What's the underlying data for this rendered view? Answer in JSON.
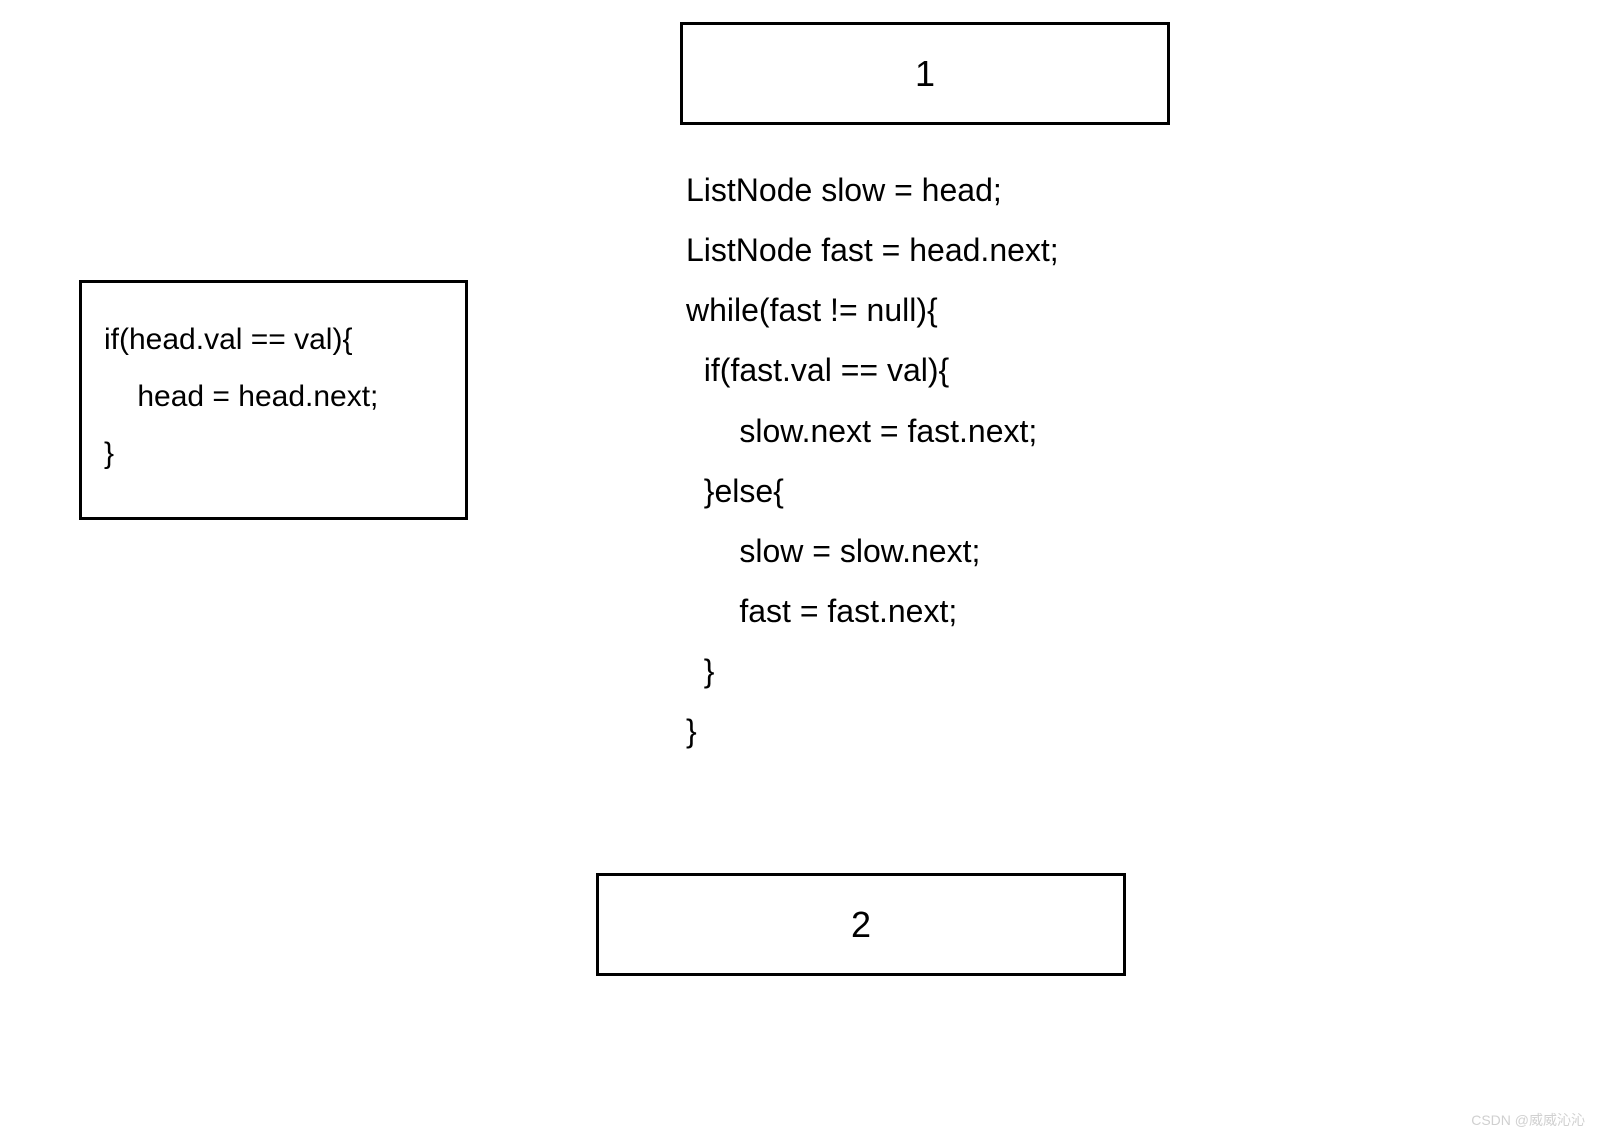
{
  "labels": {
    "top_number": "1",
    "bottom_number": "2"
  },
  "code_left": "if(head.val == val){\n    head = head.next;\n}",
  "code_right": "ListNode slow = head;\nListNode fast = head.next;\nwhile(fast != null){\n  if(fast.val == val){\n      slow.next = fast.next;\n  }else{\n      slow = slow.next;\n      fast = fast.next;\n  }\n}",
  "watermark": "CSDN @威威沁沁"
}
